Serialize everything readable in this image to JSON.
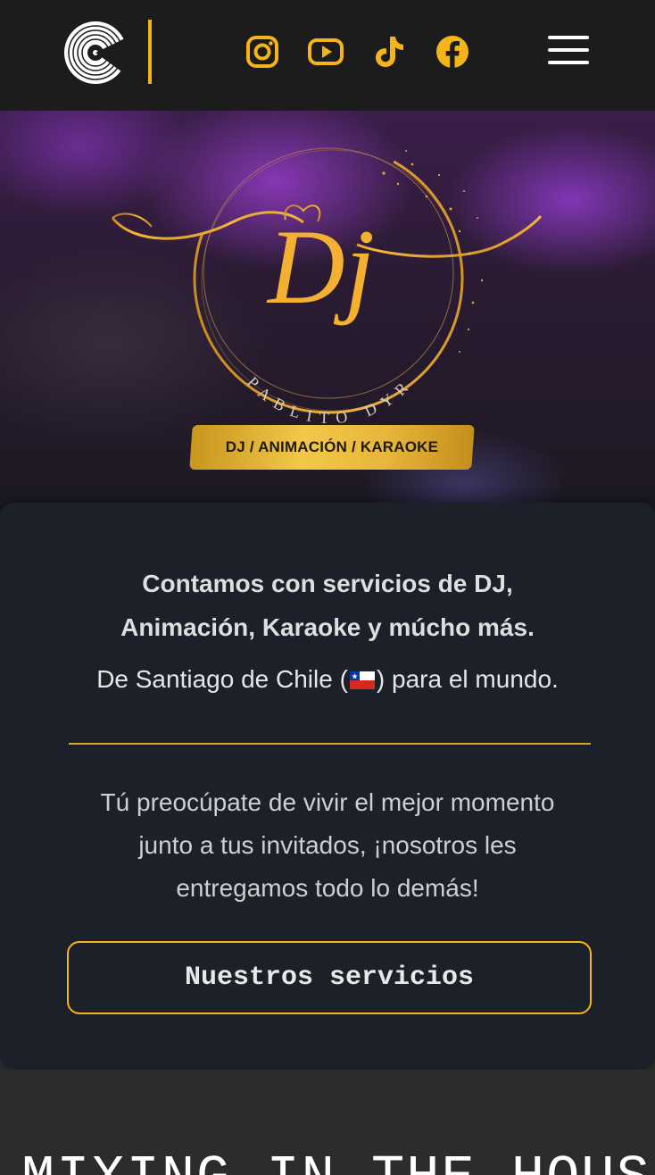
{
  "header": {
    "logo_icon": "vinyl-record-icon",
    "social": [
      {
        "name": "instagram",
        "icon": "instagram-icon"
      },
      {
        "name": "youtube",
        "icon": "youtube-icon"
      },
      {
        "name": "tiktok",
        "icon": "tiktok-icon"
      },
      {
        "name": "facebook",
        "icon": "facebook-icon"
      }
    ],
    "menu_icon": "hamburger-menu-icon",
    "accent_color": "#f4b41a"
  },
  "hero": {
    "logo_initials": "Dj",
    "logo_name": "PABLITO DYR",
    "banner_text": "DJ / ANIMACIÓN / KARAOKE"
  },
  "intro": {
    "title_line1": "Contamos con servicios de DJ,",
    "title_line2": "Animación, Karaoke y múcho más.",
    "subtitle_before": "De Santiago de Chile (",
    "subtitle_after": ") para el mundo.",
    "flag_icon": "chile-flag-icon",
    "body_line1": "Tú preocúpate de vivir el mejor momento",
    "body_line2": "junto a tus invitados, ¡nosotros les",
    "body_line3": "entregamos todo lo demás!",
    "cta_label": "Nuestros servicios"
  },
  "mix": {
    "heading": "MIXING IN THE HOUSE"
  }
}
